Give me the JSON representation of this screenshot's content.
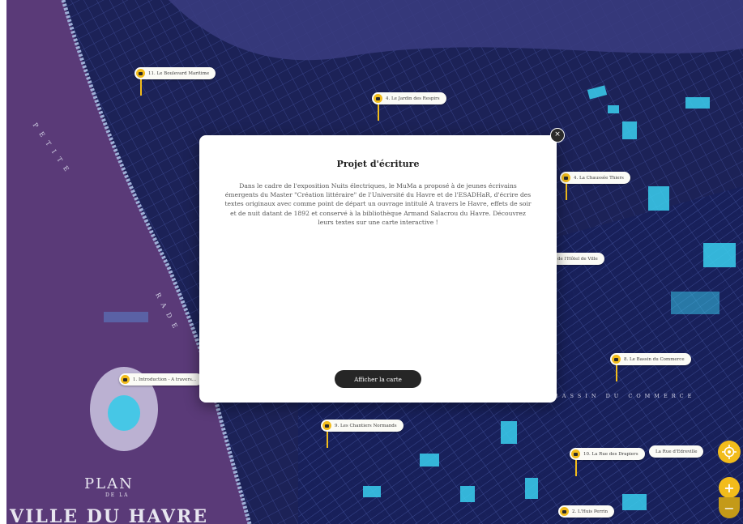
{
  "map": {
    "water_color": "#5a3a78",
    "land_color": "#1c2257",
    "highlight_color": "#3ad0f0",
    "accent_color": "#f2bc1b",
    "plan_title_line1": "PLAN",
    "plan_title_line2": "DE LA",
    "plan_title_line3": "VILLE DU HAVRE",
    "water_label_1": "PETITE",
    "water_label_2": "RADE",
    "street_label": "BASSIN DU COMMERCE"
  },
  "markers": [
    {
      "label": "11. Le Boulevard Maritime",
      "icon": "camera-icon"
    },
    {
      "label": "4. Le Jardin des Respirs",
      "icon": "camera-icon"
    },
    {
      "label": "4. La Chaussée Thiers",
      "icon": "camera-icon"
    },
    {
      "label": "de l'Hôtel de Ville",
      "icon": ""
    },
    {
      "label": "8. Le Bassin du Commerce",
      "icon": "camera-icon"
    },
    {
      "label": "1. Introduction - A travers...",
      "icon": "camera-icon"
    },
    {
      "label": "9. Les Chantiers Normands",
      "icon": "camera-icon"
    },
    {
      "label": "10. La Rue des Drapiers",
      "icon": "camera-icon"
    },
    {
      "label": "La Rue d'Edreville",
      "icon": ""
    },
    {
      "label": "2. L'Huis Perrin",
      "icon": "camera-icon"
    }
  ],
  "modal": {
    "title": "Projet d'écriture",
    "body": "Dans le cadre de l'exposition Nuits électriques, le MuMa a proposé à de jeunes écrivains émergents du Master \"Création littéraire\" de l'Université du Havre et de l'ESADHaR, d'écrire des textes originaux avec comme point de départ un ouvrage intitulé A travers le Havre, effets de soir et de nuit datant de 1892 et conservé à la bibliothèque Armand Salacrou du Havre. Découvrez leurs textes sur une carte interactive !",
    "button_label": "Afficher la carte",
    "close_symbol": "×"
  },
  "controls": {
    "zoom_in": "+",
    "zoom_out": "−",
    "locate_icon": "locate-icon"
  }
}
